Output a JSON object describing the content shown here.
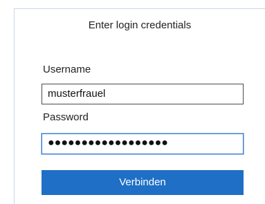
{
  "form": {
    "title": "Enter login credentials",
    "username_label": "Username",
    "username_value": "musterfrauel",
    "password_label": "Password",
    "password_value": "●●●●●●●●●●●●●●●●●●",
    "submit_label": "Verbinden"
  },
  "colors": {
    "button_background": "#1e6fc5",
    "button_text": "#ffffff",
    "focus_border": "#3d7cc9",
    "frame_border": "#c9d6e6"
  }
}
